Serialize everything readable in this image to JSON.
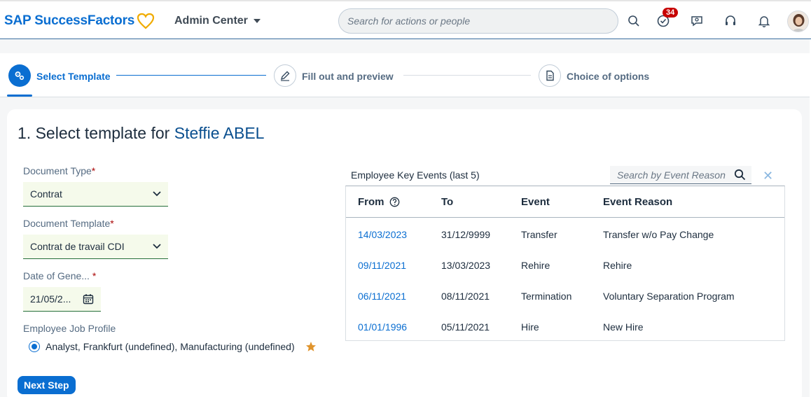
{
  "shell": {
    "logo_text": "SAP SuccessFactors",
    "module": "Admin Center",
    "search_placeholder": "Search for actions or people",
    "notification_count": "34",
    "colors": {
      "brand": "#0a6ed1",
      "heart": "#f0ab00",
      "badge": "#c70000"
    }
  },
  "wizard": {
    "steps": [
      {
        "label": "Select Template",
        "icon": "gears-icon",
        "state": "active"
      },
      {
        "label": "Fill out and preview",
        "icon": "edit-icon",
        "state": "inactive"
      },
      {
        "label": "Choice of options",
        "icon": "document-icon",
        "state": "inactive"
      }
    ]
  },
  "page": {
    "title_prefix": "1. Select template for ",
    "employee_name": "Steffie ABEL"
  },
  "form": {
    "document_type": {
      "label": "Document Type",
      "required": "*",
      "value": "Contrat"
    },
    "document_template": {
      "label": "Document Template",
      "required": "*",
      "value": "Contrat de travail CDI"
    },
    "date": {
      "label": "Date of Gene...",
      "required": "*",
      "value": "21/05/2..."
    },
    "job_profile": {
      "label": "Employee Job Profile",
      "option": "Analyst, Frankfurt (undefined), Manufacturing (undefined)"
    },
    "next_button": "Next Step"
  },
  "events": {
    "title": "Employee Key Events (last 5)",
    "search_placeholder": "Search by Event Reason",
    "columns": [
      "From",
      "To",
      "Event",
      "Event Reason"
    ],
    "rows": [
      {
        "from": "14/03/2023",
        "to": "31/12/9999",
        "event": "Transfer",
        "reason": "Transfer w/o Pay Change"
      },
      {
        "from": "09/11/2021",
        "to": "13/03/2023",
        "event": "Rehire",
        "reason": "Rehire"
      },
      {
        "from": "06/11/2021",
        "to": "08/11/2021",
        "event": "Termination",
        "reason": "Voluntary Separation Program"
      },
      {
        "from": "01/01/1996",
        "to": "05/11/2021",
        "event": "Hire",
        "reason": "New Hire"
      }
    ]
  }
}
